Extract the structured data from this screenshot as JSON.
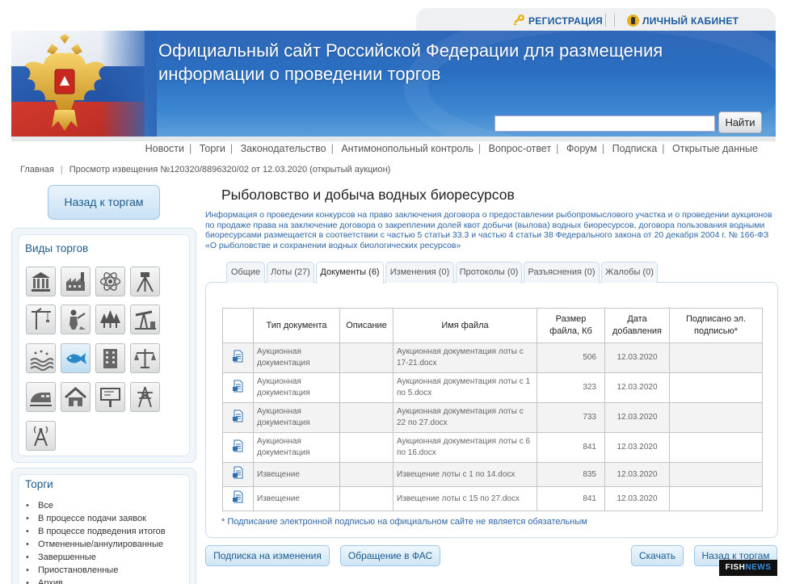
{
  "topbar": {
    "register_label": "РЕГИСТРАЦИЯ",
    "cabinet_label": "ЛИЧНЫЙ КАБИНЕТ"
  },
  "banner": {
    "title_line1": "Официальный сайт Российской Федерации для размещения",
    "title_line2": "информации о проведении торгов"
  },
  "search": {
    "value": "",
    "button_label": "Найти"
  },
  "nav": {
    "items": [
      "Новости",
      "Торги",
      "Законодательство",
      "Антимонопольный контроль",
      "Вопрос-ответ",
      "Форум",
      "Подписка",
      "Открытые данные"
    ]
  },
  "breadcrumb": {
    "home": "Главная",
    "current": "Просмотр извещения №120320/8896320/02 от 12.03.2020 (открытый аукцион)"
  },
  "sidebar": {
    "back_button": "Назад к торгам",
    "types_title": "Виды торгов",
    "type_icons": [
      "bank-icon",
      "factory-icon",
      "atom-icon",
      "theodolite-icon",
      "crane-icon",
      "miner-icon",
      "forest-icon",
      "oil-pump-icon",
      "water-icon",
      "fish-icon",
      "building-icon",
      "scales-icon",
      "train-icon",
      "house-icon",
      "billboard-icon",
      "power-line-icon",
      "antenna-icon"
    ],
    "torgi_title": "Торги",
    "torgi_items": [
      "Все",
      "В процессе подачи заявок",
      "В процессе подведения итогов",
      "Отмененные/аннулированные",
      "Завершенные",
      "Приостановленные",
      "Архив"
    ]
  },
  "main": {
    "title": "Рыболовство и добыча водных биоресурсов",
    "info": "Информация о проведении конкурсов на право заключения договора о предоставлении рыбопромыслового участка и о проведении аукционов по продаже права на заключение договора о закреплении долей квот добычи (вылова) водных биоресурсов, договора пользования водными биоресурсами размещается в соответствии с частью 5 статьи 33.3 и частью 4 статьи 38 Федерального закона от 20 декабря 2004 г. № 166-ФЗ «О рыболовстве и сохранении водных биологических ресурсов»",
    "tabs": [
      "Общие",
      "Лоты (27)",
      "Документы (6)",
      "Изменения (0)",
      "Протоколы (0)",
      "Разъяснения (0)",
      "Жалобы (0)"
    ],
    "active_tab": "Документы (6)",
    "table": {
      "headers": [
        "Тип документа",
        "Описание",
        "Имя файла",
        "Размер файла, Кб",
        "Дата добавления",
        "Подписано эл. подписью*"
      ],
      "rows": [
        {
          "type": "Аукционная документация",
          "desc": "",
          "file": "Аукционная документация лоты с 17-21.docx",
          "size": "506",
          "date": "12.03.2020",
          "signed": ""
        },
        {
          "type": "Аукционная документация",
          "desc": "",
          "file": "Аукционная документация лоты с 1 по 5.docx",
          "size": "323",
          "date": "12.03.2020",
          "signed": ""
        },
        {
          "type": "Аукционная документация",
          "desc": "",
          "file": "Аукционная документация лоты с 22 по 27.docx",
          "size": "733",
          "date": "12.03.2020",
          "signed": ""
        },
        {
          "type": "Аукционная документация",
          "desc": "",
          "file": "Аукционная документация лоты с 6 по 16.docx",
          "size": "841",
          "date": "12.03.2020",
          "signed": ""
        },
        {
          "type": "Извещение",
          "desc": "",
          "file": "Извещение лоты с 1 по 14.docx",
          "size": "835",
          "date": "12.03.2020",
          "signed": ""
        },
        {
          "type": "Извещение",
          "desc": "",
          "file": "Извещение лоты с 15 по 27.docx",
          "size": "841",
          "date": "12.03.2020",
          "signed": ""
        }
      ]
    },
    "note": "* Подписание электронной подписью на официальном сайте не является обязательным"
  },
  "buttons": {
    "subscribe": "Подписка на изменения",
    "fas": "Обращение в ФАС",
    "download": "Скачать",
    "back": "Назад к торгам"
  },
  "watermark": {
    "part1": "FISH",
    "part2": "NEWS"
  }
}
